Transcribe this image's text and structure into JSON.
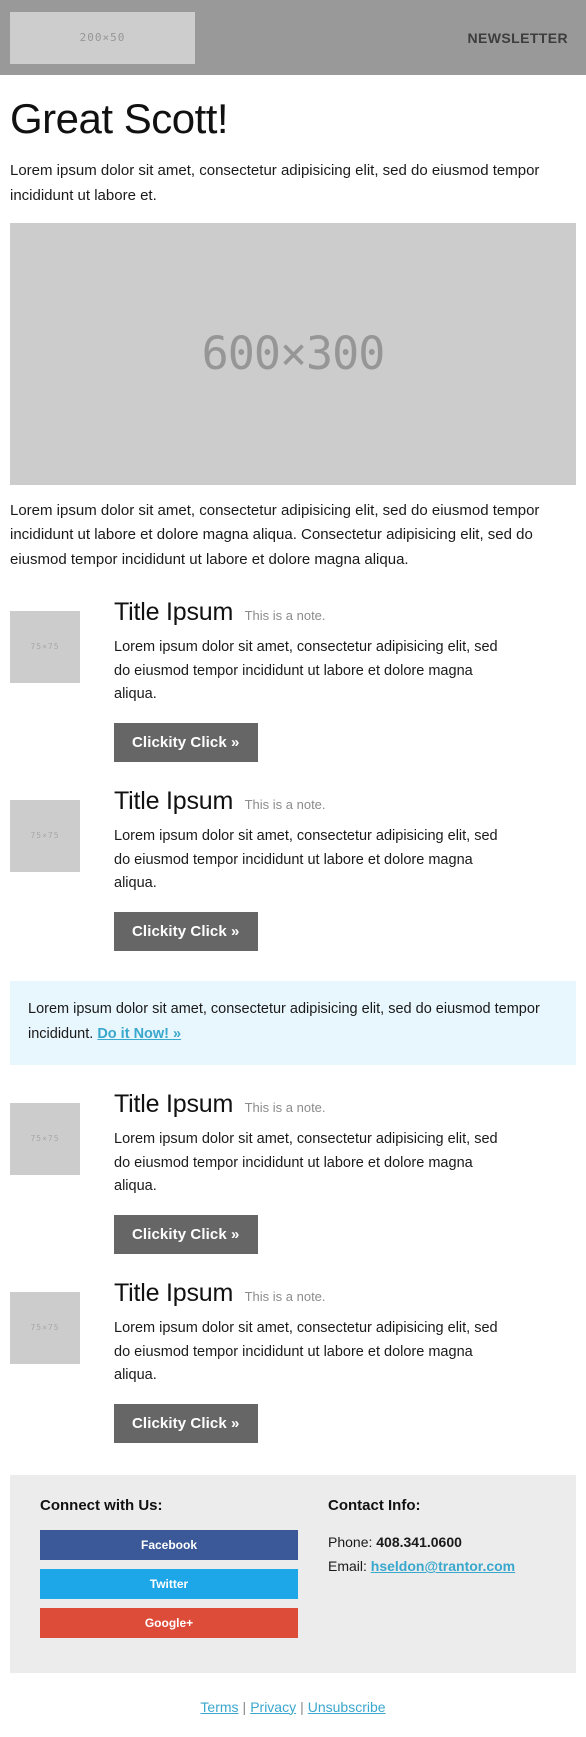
{
  "header": {
    "logo_placeholder": "200×50",
    "label": "NEWSLETTER"
  },
  "main": {
    "headline": "Great Scott!",
    "lead": "Lorem ipsum dolor sit amet, consectetur adipisicing elit, sed do eiusmod tempor incididunt ut labore et.",
    "hero_placeholder": "600×300",
    "body_copy": "Lorem ipsum dolor sit amet, consectetur adipisicing elit, sed do eiusmod tempor incididunt ut labore et dolore magna aliqua. Consectetur adipisicing elit, sed do eiusmod tempor incididunt ut labore et dolore magna aliqua."
  },
  "cards": [
    {
      "thumb": "75×75",
      "title": "Title Ipsum",
      "note": "This is a note.",
      "copy": "Lorem ipsum dolor sit amet, consectetur adipisicing elit, sed do eiusmod tempor incididunt ut labore et dolore magna aliqua.",
      "button": "Clickity Click »"
    },
    {
      "thumb": "75×75",
      "title": "Title Ipsum",
      "note": "This is a note.",
      "copy": "Lorem ipsum dolor sit amet, consectetur adipisicing elit, sed do eiusmod tempor incididunt ut labore et dolore magna aliqua.",
      "button": "Clickity Click »"
    },
    {
      "thumb": "75×75",
      "title": "Title Ipsum",
      "note": "This is a note.",
      "copy": "Lorem ipsum dolor sit amet, consectetur adipisicing elit, sed do eiusmod tempor incididunt ut labore et dolore magna aliqua.",
      "button": "Clickity Click »"
    },
    {
      "thumb": "75×75",
      "title": "Title Ipsum",
      "note": "This is a note.",
      "copy": "Lorem ipsum dolor sit amet, consectetur adipisicing elit, sed do eiusmod tempor incididunt ut labore et dolore magna aliqua.",
      "button": "Clickity Click »"
    }
  ],
  "callout": {
    "text": "Lorem ipsum dolor sit amet, consectetur adipisicing elit, sed do eiusmod tempor incididunt. ",
    "link": "Do it Now! »"
  },
  "footer": {
    "social_heading": "Connect with Us:",
    "social_buttons": [
      {
        "label": "Facebook",
        "color": "#3b5998"
      },
      {
        "label": "Twitter",
        "color": "#1da6e8"
      },
      {
        "label": "Google+",
        "color": "#dd4b39"
      }
    ],
    "contact_heading": "Contact Info:",
    "phone_label": "Phone: ",
    "phone_value": "408.341.0600",
    "email_label": "Email: ",
    "email_value": "hseldon@trantor.com"
  },
  "bottom_links": {
    "terms": "Terms",
    "privacy": "Privacy",
    "unsubscribe": "Unsubscribe",
    "separator": "|"
  },
  "colors": {
    "header_bg": "#999999",
    "placeholder_bg": "#cccccc",
    "button_gray": "#666666",
    "callout_bg": "#e8f6fd",
    "link_cyan": "#3aa7cd",
    "footer_bg": "#ececec"
  }
}
